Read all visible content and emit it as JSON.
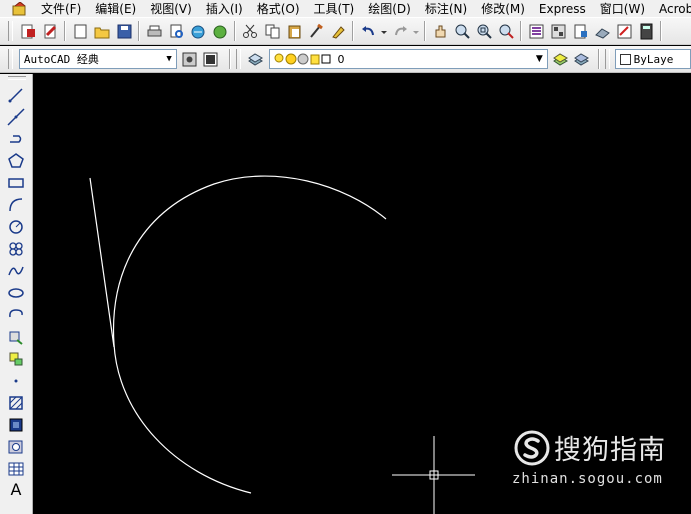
{
  "menubar": {
    "items": [
      "文件(F)",
      "编辑(E)",
      "视图(V)",
      "插入(I)",
      "格式(O)",
      "工具(T)",
      "绘图(D)",
      "标注(N)",
      "修改(M)",
      "Express",
      "窗口(W)",
      "Acrobat 标"
    ]
  },
  "toolbar2": {
    "workspace": "AutoCAD 经典",
    "layer": "0",
    "color": "ByLaye"
  },
  "left_toolbar": {
    "text_tool": "A"
  },
  "watermark": {
    "brand": "搜狗指南",
    "url": "zhinan.sogou.com"
  },
  "colors": {
    "canvas": "#000000",
    "geometry": "#ffffff",
    "chrome": "#f0f0f0"
  }
}
